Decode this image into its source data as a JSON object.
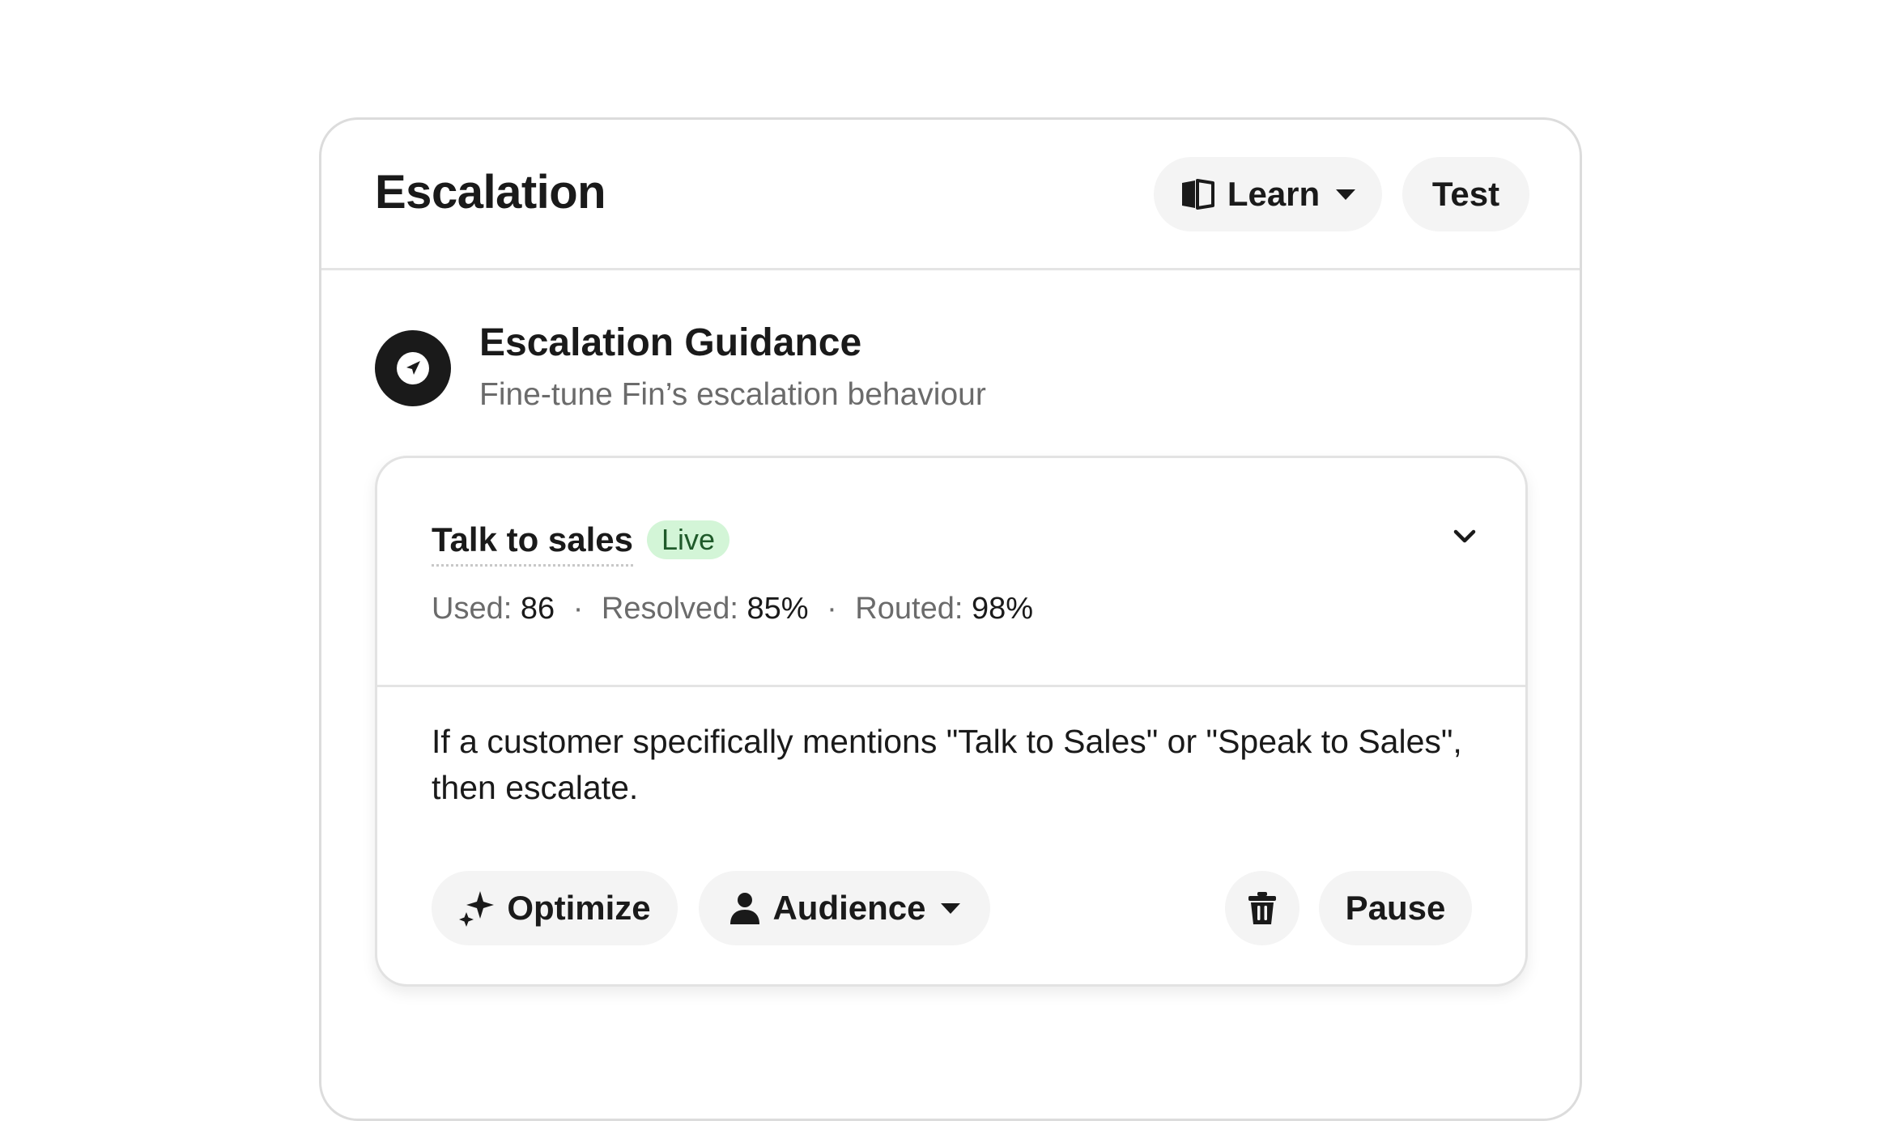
{
  "header": {
    "title": "Escalation",
    "learn_label": "Learn",
    "test_label": "Test"
  },
  "guidance": {
    "title": "Escalation Guidance",
    "subtitle": "Fine-tune Fin’s escalation behaviour"
  },
  "rule": {
    "name": "Talk to sales",
    "status": "Live",
    "stats": {
      "used_label": "Used:",
      "used_value": "86",
      "resolved_label": "Resolved:",
      "resolved_value": "85%",
      "routed_label": "Routed:",
      "routed_value": "98%",
      "separator": "·"
    },
    "instruction": "If a customer specifically mentions \"Talk to Sales\" or \"Speak to Sales\", then escalate.",
    "actions": {
      "optimize_label": "Optimize",
      "audience_label": "Audience",
      "pause_label": "Pause"
    }
  },
  "icons": {
    "learn": "book-open-icon",
    "guidance": "navigation-arrow-icon",
    "expand": "chevron-down-icon",
    "optimize": "sparkles-icon",
    "audience": "person-icon",
    "delete": "trash-icon"
  },
  "colors": {
    "live_badge_bg": "#d3f5d7",
    "live_badge_text": "#1f5a2a",
    "button_bg": "#f4f4f4",
    "icon_dark": "#1a1a1a"
  }
}
